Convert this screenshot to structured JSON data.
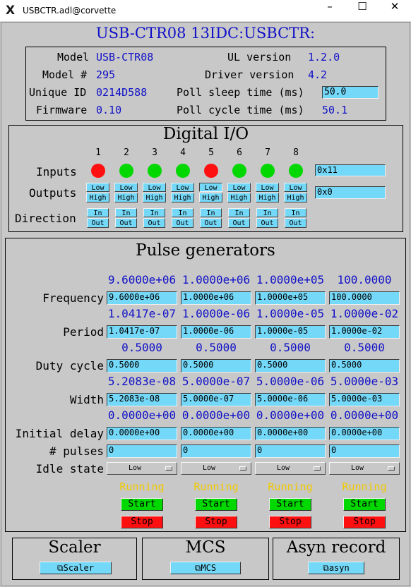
{
  "window": {
    "title": "USBCTR.adl@corvette",
    "minimize": "–",
    "maximize": "☐",
    "close": "✕"
  },
  "header": {
    "title": "USB-CTR08  13IDC:USBCTR:"
  },
  "info": {
    "model_label": "Model",
    "model": "USB-CTR08",
    "model_num_label": "Model #",
    "model_num": "295",
    "unique_id_label": "Unique ID",
    "unique_id": "0214D588",
    "firmware_label": "Firmware",
    "firmware": "0.10",
    "ul_version_label": "UL version",
    "ul_version": "1.2.0",
    "driver_version_label": "Driver version",
    "driver_version": "4.2",
    "poll_sleep_label": "Poll sleep time (ms)",
    "poll_sleep": "50.0",
    "poll_cycle_label": "Poll cycle time (ms)",
    "poll_cycle": "50.1"
  },
  "digital": {
    "title": "Digital I/O",
    "bits": [
      "1",
      "2",
      "3",
      "4",
      "5",
      "6",
      "7",
      "8"
    ],
    "inputs_label": "Inputs",
    "input_states": [
      "red",
      "green",
      "green",
      "green",
      "red",
      "green",
      "green",
      "green"
    ],
    "input_value": "0x11",
    "outputs_label": "Outputs",
    "low_label": "Low",
    "high_label": "High",
    "output_value": "0x0",
    "direction_label": "Direction",
    "in_label": "In",
    "out_label": "Out"
  },
  "pulse": {
    "title": "Pulse generators",
    "row_labels": {
      "frequency": "Frequency",
      "period": "Period",
      "duty": "Duty cycle",
      "width": "Width",
      "delay": "Initial delay",
      "pulses": "# pulses",
      "idle": "Idle state"
    },
    "channels": [
      {
        "freq_rb": "9.6000e+06",
        "freq": "9.6000e+06",
        "period_rb": "1.0417e-07",
        "period": "1.0417e-07",
        "duty_rb": "0.5000",
        "duty": "0.5000",
        "width_rb": "5.2083e-08",
        "width": "5.2083e-08",
        "delay_rb": "0.0000e+00",
        "delay": "0.0000e+00",
        "pulses": "0",
        "idle": "Low",
        "status": "Running",
        "start": "Start",
        "stop": "Stop"
      },
      {
        "freq_rb": "1.0000e+06",
        "freq": "1.0000e+06",
        "period_rb": "1.0000e-06",
        "period": "1.0000e-06",
        "duty_rb": "0.5000",
        "duty": "0.5000",
        "width_rb": "5.0000e-07",
        "width": "5.0000e-07",
        "delay_rb": "0.0000e+00",
        "delay": "0.0000e+00",
        "pulses": "0",
        "idle": "Low",
        "status": "Running",
        "start": "Start",
        "stop": "Stop"
      },
      {
        "freq_rb": "1.0000e+05",
        "freq": "1.0000e+05",
        "period_rb": "1.0000e-05",
        "period": "1.0000e-05",
        "duty_rb": "0.5000",
        "duty": "0.5000",
        "width_rb": "5.0000e-06",
        "width": "5.0000e-06",
        "delay_rb": "0.0000e+00",
        "delay": "0.0000e+00",
        "pulses": "0",
        "idle": "Low",
        "status": "Running",
        "start": "Start",
        "stop": "Stop"
      },
      {
        "freq_rb": "100.0000",
        "freq": "100.0000",
        "period_rb": "1.0000e-02",
        "period": "1.0000e-02",
        "duty_rb": "0.5000",
        "duty": "0.5000",
        "width_rb": "5.0000e-03",
        "width": "5.0000e-03",
        "delay_rb": "0.0000e+00",
        "delay": "0.0000e+00",
        "pulses": "0",
        "idle": "Low",
        "status": "Running",
        "start": "Start",
        "stop": "Stop"
      }
    ]
  },
  "bottom": {
    "scaler_title": "Scaler",
    "scaler_btn": "⧉Scaler",
    "mcs_title": "MCS",
    "mcs_btn": "⧉MCS",
    "asyn_title": "Asyn record",
    "asyn_btn": "⧉asyn"
  },
  "colors": {
    "led_green": "#00d800",
    "led_red": "#ff1010",
    "readback": "#1010c8",
    "status": "#f0c800",
    "field": "#74d8f8"
  }
}
